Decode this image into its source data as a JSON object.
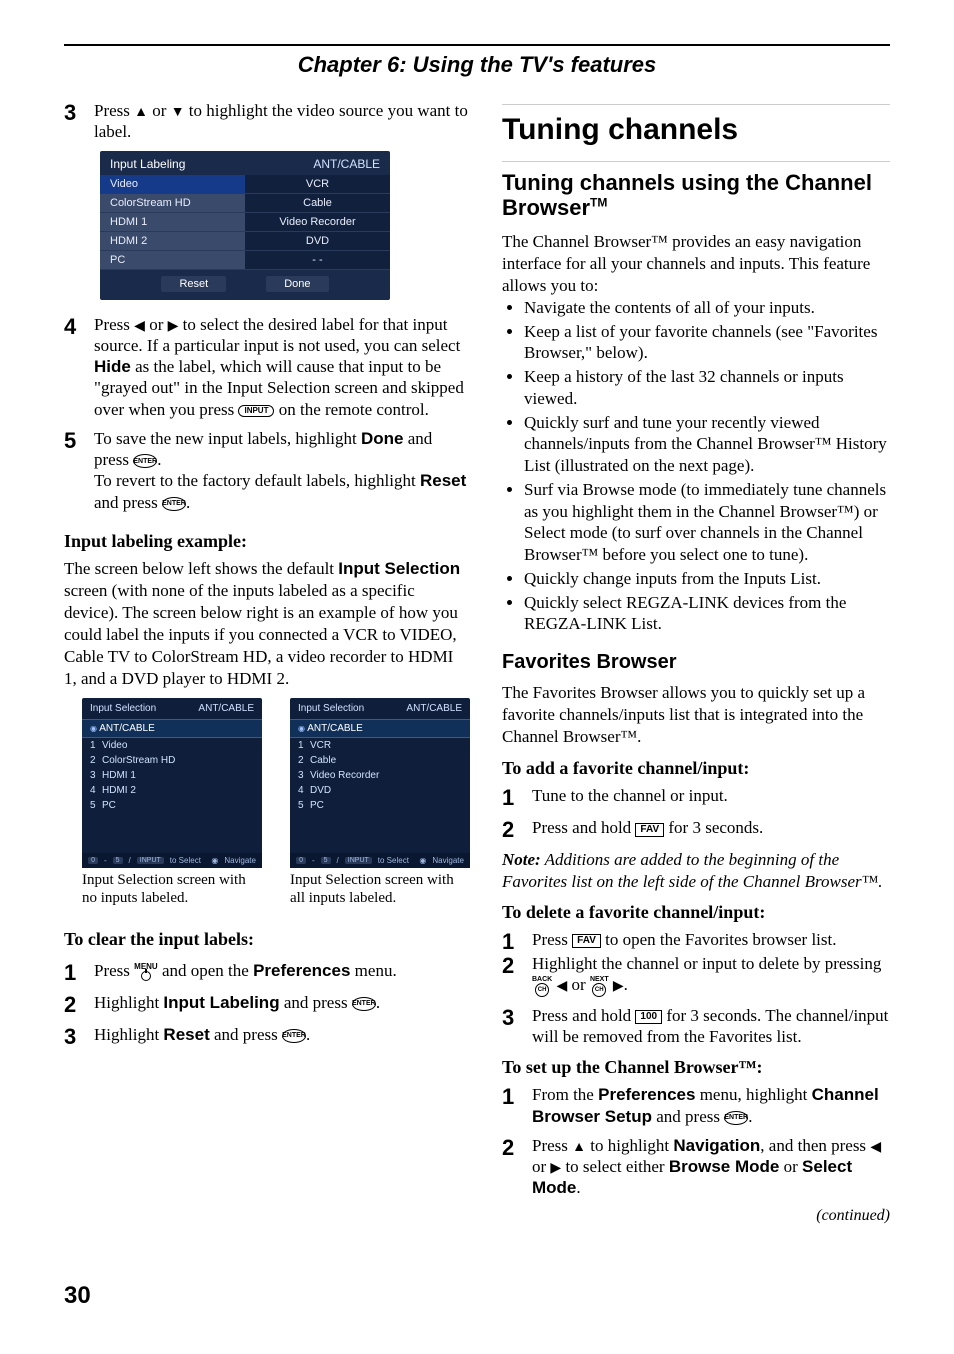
{
  "chapter": "Chapter 6: Using the TV's features",
  "page_number": "30",
  "continued": "(continued)",
  "left": {
    "step3_a": "Press ",
    "step3_b": " or ",
    "step3_c": " to highlight the video source you want to label.",
    "osd_labeling": {
      "title": "Input Labeling",
      "right": "ANT/CABLE",
      "rows": [
        {
          "l": "Video",
          "r": "VCR"
        },
        {
          "l": "ColorStream HD",
          "r": "Cable"
        },
        {
          "l": "HDMI 1",
          "r": "Video Recorder"
        },
        {
          "l": "HDMI 2",
          "r": "DVD"
        },
        {
          "l": "PC",
          "r": "- -"
        }
      ],
      "reset": "Reset",
      "done": "Done"
    },
    "step4_a": "Press ",
    "step4_b": " or ",
    "step4_c": " to select the desired label for that input source. If a particular input is not used, you can select ",
    "step4_hide": "Hide",
    "step4_d": " as the label, which will cause that input to be \"grayed out\" in the Input Selection screen and skipped over when you press ",
    "step4_input": "INPUT",
    "step4_e": " on the remote control.",
    "step5_a": "To save the new input labels, highlight ",
    "step5_done": "Done",
    "step5_b": " and press ",
    "step5_enter": "ENTER",
    "step5_c": ".",
    "step5_rev_a": "To revert to the factory default labels, highlight ",
    "step5_reset": "Reset",
    "step5_rev_b": " and press ",
    "step5_rev_c": ".",
    "ex_h": "Input labeling example:",
    "ex_p_a": "The screen below left shows the default ",
    "ex_p_b": "Input Selection",
    "ex_p_c": " screen (with none of the inputs labeled as a specific device). The screen below right is an example of how you could label the inputs if you connected a VCR to VIDEO, Cable TV to ColorStream HD, a video recorder to HDMI 1, and a DVD player to HDMI 2.",
    "selA": {
      "title": "Input Selection",
      "right": "ANT/CABLE",
      "ant": "ANT/CABLE",
      "rows": [
        {
          "n": "1",
          "t": "Video"
        },
        {
          "n": "2",
          "t": "ColorStream HD"
        },
        {
          "n": "3",
          "t": "HDMI 1"
        },
        {
          "n": "4",
          "t": "HDMI 2"
        },
        {
          "n": "5",
          "t": "PC"
        }
      ],
      "caption": "Input Selection screen with no inputs labeled."
    },
    "selB": {
      "title": "Input Selection",
      "right": "ANT/CABLE",
      "ant": "ANT/CABLE",
      "rows": [
        {
          "n": "1",
          "t": "VCR"
        },
        {
          "n": "2",
          "t": "Cable"
        },
        {
          "n": "3",
          "t": "Video Recorder"
        },
        {
          "n": "4",
          "t": "DVD"
        },
        {
          "n": "5",
          "t": "PC"
        }
      ],
      "caption": "Input Selection screen with all inputs labeled."
    },
    "foot_nav": "Navigate",
    "foot_sel": "to Select",
    "foot_input": "INPUT",
    "clear_h": "To clear the input labels:",
    "c1_a": "Press ",
    "c1_menu": "MENU",
    "c1_b": " and open the ",
    "c1_pref": "Preferences",
    "c1_c": " menu.",
    "c2_a": "Highlight ",
    "c2_il": "Input Labeling",
    "c2_b": " and press ",
    "c2_c": ".",
    "c3_a": "Highlight ",
    "c3_reset": "Reset",
    "c3_b": " and press ",
    "c3_c": "."
  },
  "right": {
    "h1": "Tuning channels",
    "h2_a": "Tuning channels using the Channel Browser",
    "h2_tm": "TM",
    "intro": "The Channel Browser™ provides an easy navigation interface for all your channels and inputs. This feature allows you to:",
    "bullets": [
      "Navigate the contents of all of your inputs.",
      "Keep a list of your favorite channels (see \"Favorites Browser,\" below).",
      "Keep a history of the last 32 channels or inputs viewed.",
      "Quickly surf and tune your recently viewed channels/inputs from the Channel Browser™ History List (illustrated on the next page).",
      "Surf via Browse mode (to immediately tune channels as you highlight them in the Channel Browser™) or Select mode (to surf over channels in the Channel Browser™ before you select one to tune).",
      "Quickly change inputs from the Inputs List.",
      "Quickly select REGZA-LINK devices from the REGZA-LINK List."
    ],
    "fav_h": "Favorites Browser",
    "fav_p": "The Favorites Browser allows you to quickly set up a favorite channels/inputs list that is integrated into the Channel Browser™.",
    "add_h": "To add a favorite channel/input:",
    "add1": "Tune to the channel or input.",
    "add2_a": "Press and hold ",
    "add2_fav": "FAV",
    "add2_b": " for 3 seconds.",
    "note_b": "Note:",
    "note": " Additions are added to the beginning of the Favorites list on the left side of the Channel Browser™.",
    "del_h": "To delete a favorite channel/input:",
    "del1_a": "Press ",
    "del1_fav": "FAV",
    "del1_b": " to open the Favorites browser list.",
    "del2_a": "Highlight the channel or input to delete by pressing ",
    "del2_back": "BACK",
    "del2_b": " ",
    "del2_c": " or ",
    "del2_next": "NEXT",
    "del2_d": " ",
    "del2_e": ".",
    "del3_a": "Press and hold ",
    "del3_100": "100",
    "del3_b": " for 3 seconds. The channel/input will be removed from the Favorites list.",
    "set_h": "To set up the Channel Browser™:",
    "set1_a": "From the ",
    "set1_pref": "Preferences",
    "set1_b": " menu, highlight ",
    "set1_cbs": "Channel Browser Setup",
    "set1_c": " and press ",
    "set1_d": ".",
    "set2_a": "Press ",
    "set2_b": " to highlight ",
    "set2_nav": "Navigation",
    "set2_c": ", and then press ",
    "set2_d": " or ",
    "set2_e": " to select either ",
    "set2_bm": "Browse Mode",
    "set2_f": " or ",
    "set2_sm": "Select Mode",
    "set2_g": ".",
    "ch_label": "CH"
  }
}
